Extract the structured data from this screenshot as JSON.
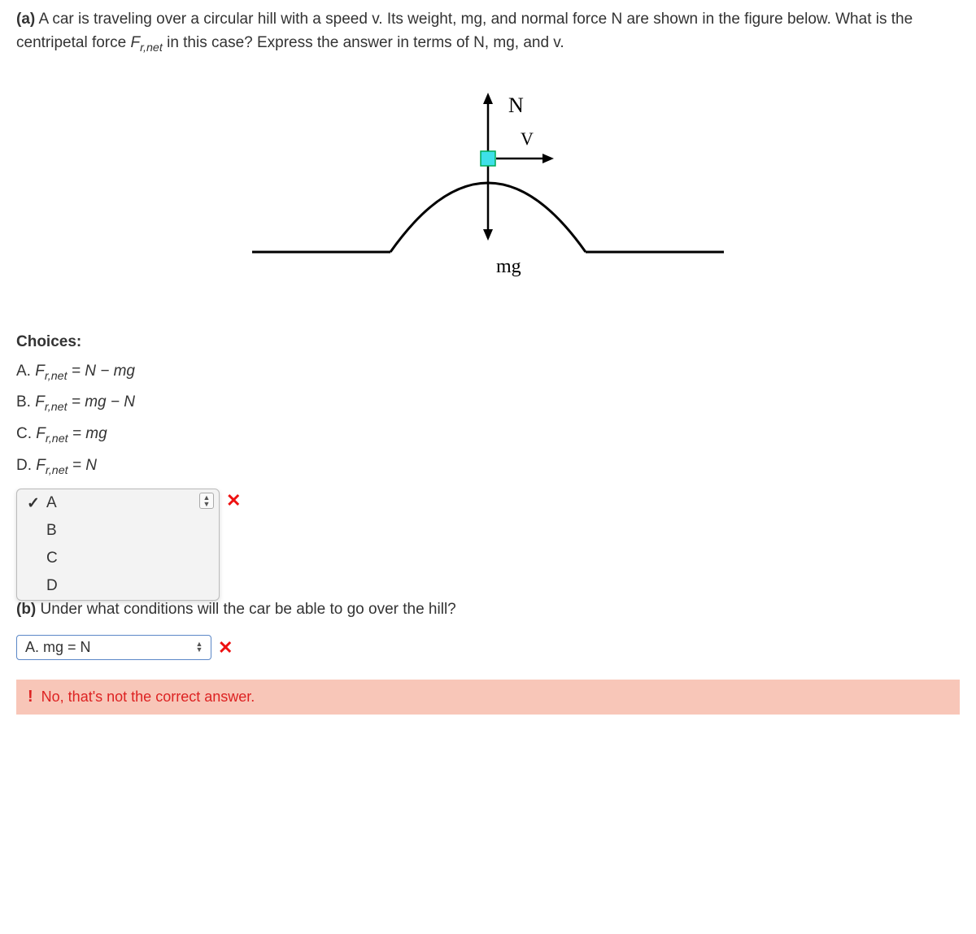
{
  "partA": {
    "label": "(a)",
    "text_1": " A car is traveling over a circular hill with a speed v. Its weight, mg, and normal force N are shown in the figure below. What is the centripetal force ",
    "force_symbol_main": "F",
    "force_symbol_sub": "r,net",
    "text_2": " in this case? Express the answer in terms of N, mg, and v."
  },
  "figure": {
    "label_N": "N",
    "label_V": "V",
    "label_mg": "mg"
  },
  "choices": {
    "header": "Choices:",
    "items": [
      {
        "letter": "A. ",
        "lhs_main": "F",
        "lhs_sub": "r,net",
        "rhs": " = N − mg"
      },
      {
        "letter": "B. ",
        "lhs_main": "F",
        "lhs_sub": "r,net",
        "rhs": " = mg − N"
      },
      {
        "letter": "C. ",
        "lhs_main": "F",
        "lhs_sub": "r,net",
        "rhs": " = mg"
      },
      {
        "letter": "D. ",
        "lhs_main": "F",
        "lhs_sub": "r,net",
        "rhs": " = N"
      }
    ]
  },
  "dropdownA": {
    "options": [
      "A",
      "B",
      "C",
      "D"
    ],
    "selected_index": 0,
    "wrong_mark": "✕"
  },
  "partB": {
    "label": "(b)",
    "text": " Under what conditions will the car be able to go over the hill?"
  },
  "dropdownB": {
    "selected_label": "A.  mg = N",
    "wrong_mark": "✕"
  },
  "feedback": {
    "exclaim": "!",
    "text": "No, that's not the correct answer."
  }
}
